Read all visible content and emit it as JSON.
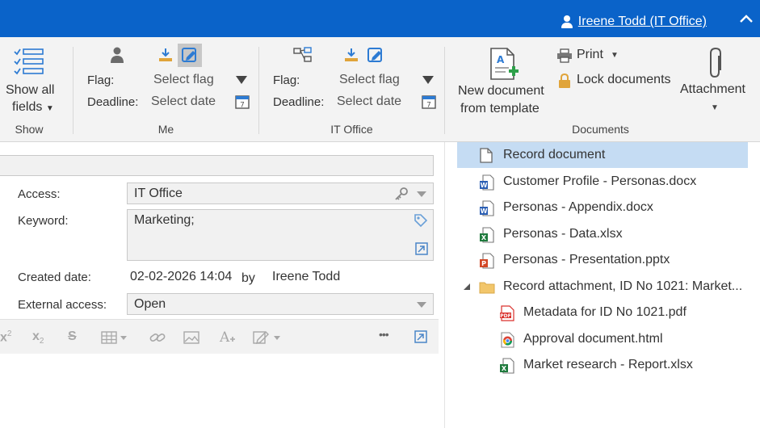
{
  "header": {
    "user_name": "Ireene Todd (IT Office)"
  },
  "ribbon": {
    "show_group": {
      "button_label_line1": "Show all",
      "button_label_line2": "fields",
      "group_label": "Show"
    },
    "me_group": {
      "flag_label": "Flag:",
      "flag_value": "Select flag",
      "deadline_label": "Deadline:",
      "deadline_value": "Select date",
      "group_label": "Me"
    },
    "office_group": {
      "flag_label": "Flag:",
      "flag_value": "Select flag",
      "deadline_label": "Deadline:",
      "deadline_value": "Select date",
      "group_label": "IT Office"
    },
    "documents_group": {
      "new_doc_line1": "New document",
      "new_doc_line2": "from template",
      "print_label": "Print",
      "lock_label": "Lock documents",
      "attachment_label": "Attachment",
      "group_label": "Documents"
    }
  },
  "form": {
    "access_label": "Access:",
    "access_value": "IT Office",
    "keyword_label": "Keyword:",
    "keyword_value": "Marketing;",
    "created_label": "Created date:",
    "created_value": "02-02-2026 14:04",
    "by_label": "by",
    "created_by": "Ireene Todd",
    "external_label": "External access:",
    "external_value": "Open",
    "toolbar_more": "•••"
  },
  "tree": {
    "items": [
      {
        "name": "Record document",
        "icon": "blank-doc-icon",
        "selected": true
      },
      {
        "name": "Customer Profile - Personas.docx",
        "icon": "word-icon"
      },
      {
        "name": "Personas - Appendix.docx",
        "icon": "word-icon"
      },
      {
        "name": "Personas - Data.xlsx",
        "icon": "excel-icon"
      },
      {
        "name": "Personas  - Presentation.pptx",
        "icon": "powerpoint-icon"
      },
      {
        "name": "Record attachment, ID No 1021: Market...",
        "icon": "folder-icon",
        "expanded": true
      },
      {
        "name": "Metadata for ID No 1021.pdf",
        "icon": "pdf-icon"
      },
      {
        "name": "Approval document.html",
        "icon": "chrome-icon"
      },
      {
        "name": "Market research - Report.xlsx",
        "icon": "excel-icon"
      }
    ]
  },
  "colors": {
    "brand_blue": "#0a63c9",
    "selection": "#c5dcf3",
    "word": "#2b5fb4",
    "excel": "#1f7a3d",
    "powerpoint": "#d24726",
    "pdf": "#d9302c",
    "folder": "#f2c66b"
  }
}
